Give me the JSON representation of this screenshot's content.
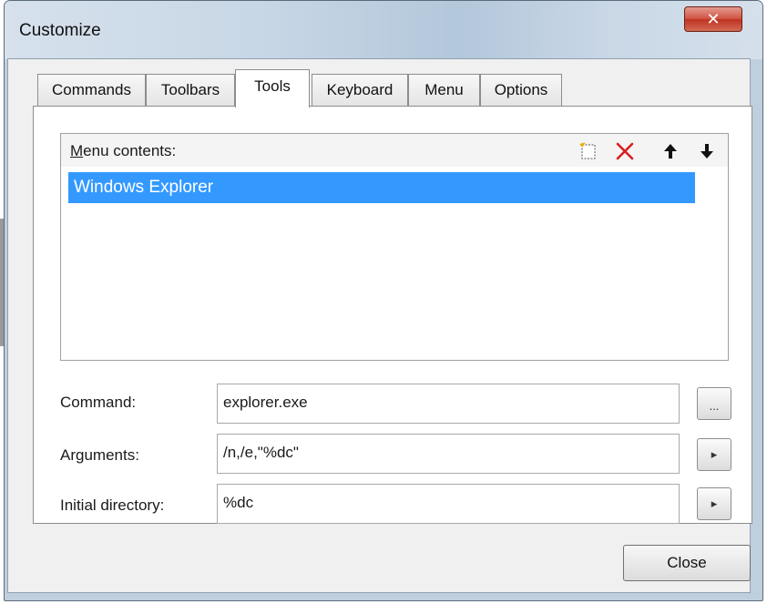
{
  "window": {
    "title": "Customize",
    "close_glyph": "✕"
  },
  "tabs": [
    {
      "label": "Commands"
    },
    {
      "label": "Toolbars"
    },
    {
      "label": "Tools"
    },
    {
      "label": "Keyboard"
    },
    {
      "label": "Menu"
    },
    {
      "label": "Options"
    }
  ],
  "active_tab": "Tools",
  "menu_contents": {
    "label_first_letter": "M",
    "label_rest": "enu contents:",
    "toolbar_icons": [
      "new-item-icon",
      "delete-icon",
      "move-up-icon",
      "move-down-icon"
    ],
    "items": [
      {
        "label": "Windows Explorer",
        "selected": true
      }
    ]
  },
  "fields": {
    "command": {
      "label": "Command:",
      "value": "explorer.exe",
      "button_label": "..."
    },
    "arguments": {
      "label": "Arguments:",
      "value": "/n,/e,\"%dc\"",
      "button_glyph": "▸"
    },
    "initial_directory": {
      "label": "Initial directory:",
      "value": "%dc",
      "button_glyph": "▸"
    }
  },
  "buttons": {
    "close": "Close"
  },
  "colors": {
    "selection": "#3399ff",
    "close_button": "#c9412f"
  }
}
